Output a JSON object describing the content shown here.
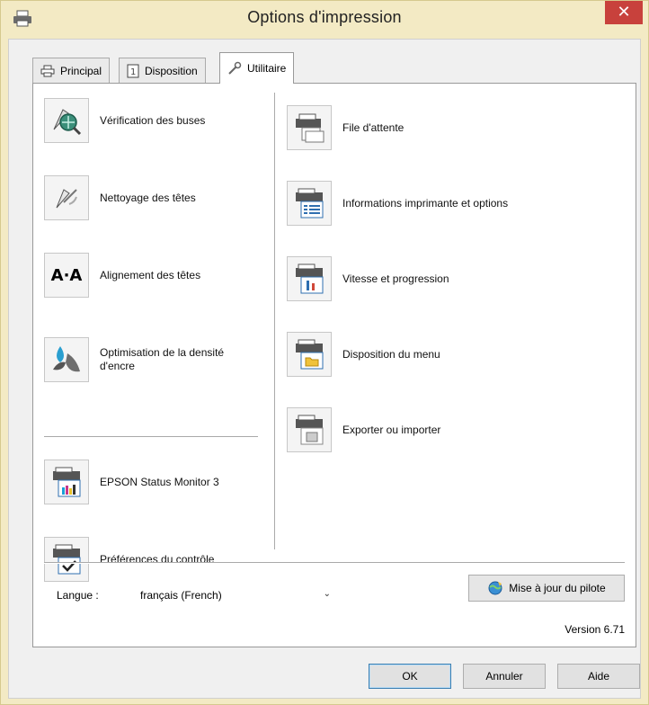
{
  "window": {
    "title": "Options d'impression",
    "close_glyph": "✕"
  },
  "tabs": [
    {
      "label": "Principal",
      "icon": "printer-icon",
      "active": false
    },
    {
      "label": "Disposition",
      "icon": "page-layout-icon",
      "active": false
    },
    {
      "label": "Utilitaire",
      "icon": "wrench-icon",
      "active": true
    }
  ],
  "utilities_left": [
    {
      "label": "Vérification des buses",
      "icon": "nozzle-check-icon"
    },
    {
      "label": "Nettoyage des têtes",
      "icon": "head-cleaning-icon"
    },
    {
      "label": "Alignement des têtes",
      "icon": "head-alignment-icon",
      "icon_text": "A·A"
    },
    {
      "label": "Optimisation de la densité d'encre",
      "icon": "ink-density-icon"
    },
    {
      "label": "EPSON Status Monitor 3",
      "icon": "status-monitor-icon"
    },
    {
      "label": "Préférences du contrôle",
      "icon": "monitoring-preferences-icon"
    }
  ],
  "utilities_right": [
    {
      "label": "File d'attente",
      "icon": "print-queue-icon"
    },
    {
      "label": "Informations imprimante et options",
      "icon": "printer-info-icon"
    },
    {
      "label": "Vitesse et progression",
      "icon": "speed-progress-icon"
    },
    {
      "label": "Disposition du menu",
      "icon": "menu-arrangement-icon"
    },
    {
      "label": "Exporter ou importer",
      "icon": "export-import-icon"
    }
  ],
  "language": {
    "label": "Langue :",
    "value": "français (French)",
    "arrow": "⌄"
  },
  "driver_update": {
    "label": "Mise à jour du pilote",
    "icon": "globe-update-icon"
  },
  "version": "Version 6.71",
  "footer": {
    "ok": "OK",
    "cancel": "Annuler",
    "help": "Aide"
  },
  "colors": {
    "title_bar": "#f3eac4",
    "close_button": "#c8413c",
    "panel": "#ffffff",
    "default_button_border": "#3c7fb1"
  }
}
